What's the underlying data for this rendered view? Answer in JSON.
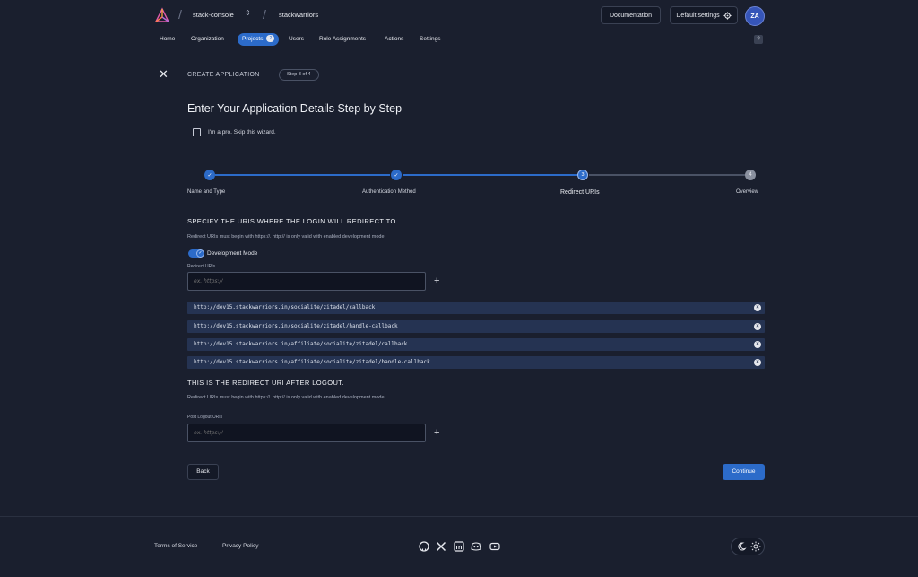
{
  "header": {
    "org_name": "stack-console",
    "project_name": "stackwarriors",
    "documentation_label": "Documentation",
    "default_settings_label": "Default settings",
    "avatar_initials": "ZA",
    "help_label": "?"
  },
  "nav": {
    "items": [
      {
        "label": "Home"
      },
      {
        "label": "Organization"
      },
      {
        "label": "Projects",
        "count": "2"
      },
      {
        "label": "Users"
      },
      {
        "label": "Role Assignments"
      },
      {
        "label": "Actions"
      },
      {
        "label": "Settings"
      }
    ]
  },
  "wizard": {
    "create_label": "CREATE APPLICATION",
    "step_pill": "Step 3 of 4",
    "title": "Enter Your Application Details Step by Step",
    "skip_label": "I'm a pro. Skip this wizard.",
    "steps": [
      {
        "label": "Name and Type",
        "number": "1",
        "status": "done"
      },
      {
        "label": "Authentication Method",
        "number": "2",
        "status": "done"
      },
      {
        "label": "Redirect URIs",
        "number": "3",
        "status": "current"
      },
      {
        "label": "Overview",
        "number": "4",
        "status": "todo"
      }
    ],
    "redirect_section": {
      "title": "SPECIFY THE URIS WHERE THE LOGIN WILL REDIRECT TO.",
      "help": "Redirect URIs must begin with https://. http:// is only valid with enabled development mode.",
      "dev_mode_label": "Development Mode",
      "dev_mode_on": true,
      "field_label": "Redirect URIs",
      "placeholder": "ex. https://",
      "uris": [
        "http://dev15.stackwarriors.in/socialite/zitadel/callback",
        "http://dev15.stackwarriors.in/socialite/zitadel/handle-callback",
        "http://dev15.stackwarriors.in/affiliate/socialite/zitadel/callback",
        "http://dev15.stackwarriors.in/affiliate/socialite/zitadel/handle-callback"
      ]
    },
    "logout_section": {
      "title": "THIS IS THE REDIRECT URI AFTER LOGOUT.",
      "help": "Redirect URIs must begin with https://. http:// is only valid with enabled development mode.",
      "field_label": "Post Logout URIs",
      "placeholder": "ex. https://"
    },
    "back_label": "Back",
    "continue_label": "Continue"
  },
  "footer": {
    "terms_label": "Terms of Service",
    "privacy_label": "Privacy Policy",
    "social_icons": [
      "github-icon",
      "x-icon",
      "linkedin-icon",
      "discord-icon",
      "youtube-icon"
    ]
  },
  "colors": {
    "background": "#1a1f2e",
    "accent": "#2c6bc9",
    "uri_row": "#253352"
  }
}
